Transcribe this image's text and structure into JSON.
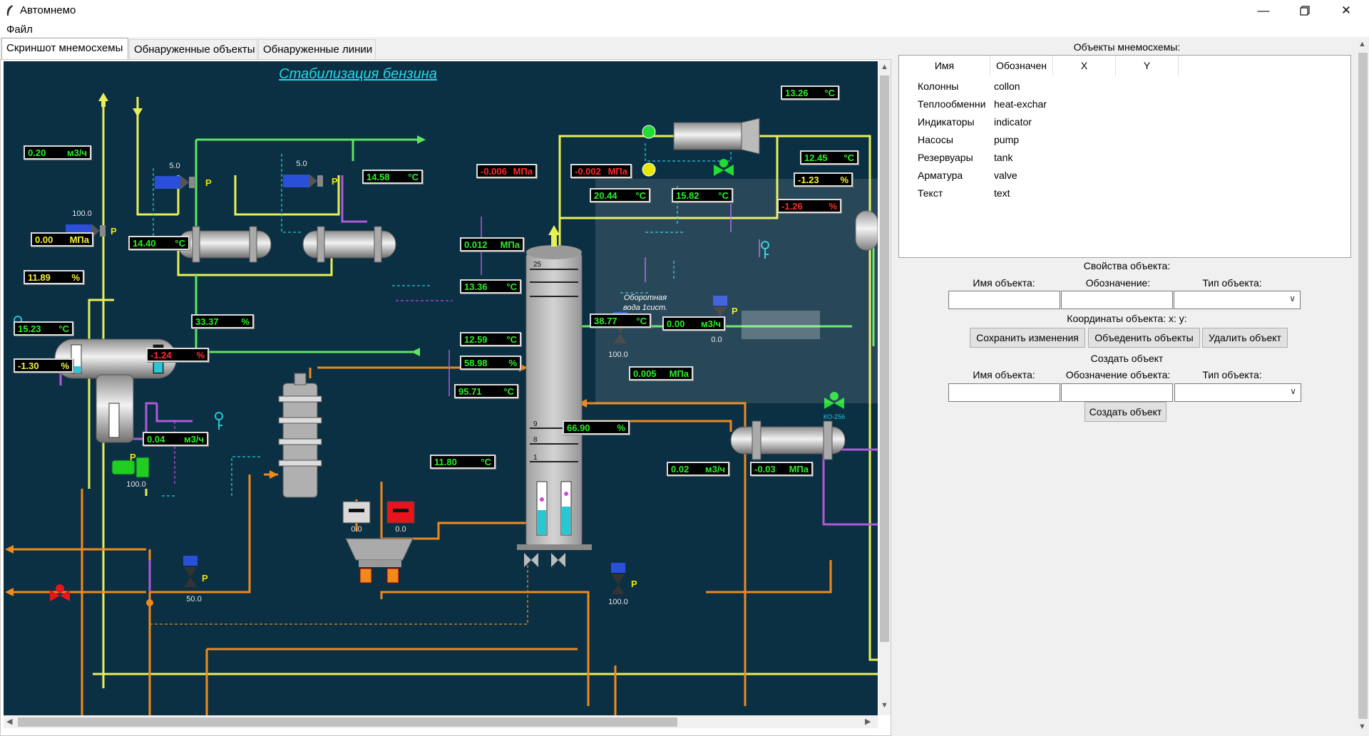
{
  "window": {
    "title": "Автомнемо",
    "menu_file": "Файл"
  },
  "tabs": [
    {
      "label": "Скриншот мнемосхемы",
      "active": true
    },
    {
      "label": "Обнаруженные объекты",
      "active": false
    },
    {
      "label": "Обнаруженные линии",
      "active": false
    }
  ],
  "scheme": {
    "title": "Стабилизация бензина",
    "annotation": "Оборотная вода 1сист.",
    "column_trays": [
      "25",
      "9",
      "8",
      "1"
    ],
    "indicators": [
      {
        "value": "0.20",
        "unit": "м3/ч",
        "color": "green"
      },
      {
        "value": "0.00",
        "unit": "МПа",
        "color": "yellow"
      },
      {
        "value": "14.40",
        "unit": "°С",
        "color": "green"
      },
      {
        "value": "11.89",
        "unit": "%",
        "color": "yellow"
      },
      {
        "value": "15.23",
        "unit": "°С",
        "color": "green"
      },
      {
        "value": "-1.30",
        "unit": "%",
        "color": "yellow"
      },
      {
        "value": "33.37",
        "unit": "%",
        "color": "green"
      },
      {
        "value": "-1.24",
        "unit": "%",
        "color": "red"
      },
      {
        "value": "14.58",
        "unit": "°С",
        "color": "green"
      },
      {
        "value": "0.04",
        "unit": "м3/ч",
        "color": "green"
      },
      {
        "value": "-0.006",
        "unit": "МПа",
        "color": "red"
      },
      {
        "value": "0.012",
        "unit": "МПа",
        "color": "green"
      },
      {
        "value": "13.36",
        "unit": "°С",
        "color": "green"
      },
      {
        "value": "12.59",
        "unit": "°С",
        "color": "green"
      },
      {
        "value": "58.98",
        "unit": "%",
        "color": "green"
      },
      {
        "value": "95.71",
        "unit": "°С",
        "color": "green"
      },
      {
        "value": "11.80",
        "unit": "°С",
        "color": "green"
      },
      {
        "value": "66.90",
        "unit": "%",
        "color": "green"
      },
      {
        "value": "-0.002",
        "unit": "МПа",
        "color": "red"
      },
      {
        "value": "20.44",
        "unit": "°С",
        "color": "green"
      },
      {
        "value": "15.82",
        "unit": "°С",
        "color": "green"
      },
      {
        "value": "38.77",
        "unit": "°С",
        "color": "green"
      },
      {
        "value": "0.00",
        "unit": "м3/ч",
        "color": "green"
      },
      {
        "value": "0.005",
        "unit": "МПа",
        "color": "green"
      },
      {
        "value": "0.02",
        "unit": "м3/ч",
        "color": "green"
      },
      {
        "value": "-0.03",
        "unit": "МПа",
        "color": "green"
      },
      {
        "value": "13.26",
        "unit": "°С",
        "color": "green"
      },
      {
        "value": "12.45",
        "unit": "°С",
        "color": "green"
      },
      {
        "value": "-1.23",
        "unit": "%",
        "color": "yellow"
      },
      {
        "value": "-1.26",
        "unit": "%",
        "color": "red"
      }
    ],
    "valve_values": [
      "5.0",
      "5.0",
      "100.0",
      "100.0",
      "50.0",
      "0.0",
      "100.0",
      "100.0",
      "0.0",
      "0.0"
    ],
    "valve_tag": "КО-256",
    "valve_letter": "P"
  },
  "right_panel": {
    "objects_title": "Объекты мнемосхемы:",
    "columns": [
      "Имя",
      "Обозначен",
      "X",
      "Y"
    ],
    "rows": [
      {
        "name": "Колонны",
        "code": "collon"
      },
      {
        "name": "Теплообменни",
        "code": "heat-exchar"
      },
      {
        "name": "Индикаторы",
        "code": "indicator"
      },
      {
        "name": "Насосы",
        "code": "pump"
      },
      {
        "name": "Резервуары",
        "code": "tank"
      },
      {
        "name": "Арматура",
        "code": "valve"
      },
      {
        "name": "Текст",
        "code": "text"
      }
    ],
    "props_title": "Свойства объекта:",
    "prop_name_label": "Имя объекта:",
    "prop_code_label": "Обозначение:",
    "prop_type_label": "Тип объекта:",
    "coords_label": "Координаты объекта: x:  y:",
    "save_button": "Сохранить изменения",
    "merge_button": "Объеденить объекты",
    "delete_button": "Удалить объект",
    "create_title": "Создать объект",
    "create_name_label": "Имя объекта:",
    "create_code_label": "Обозначение объекта:",
    "create_type_label": "Тип объекта:",
    "create_button": "Создать объект"
  },
  "colors": {
    "scheme_bg": "#0b2f43",
    "yellow_pipe": "#e8f055",
    "green_pipe": "#5ee660",
    "orange_pipe": "#f08a1c",
    "violet_line": "#b05ad8",
    "cyan_dash": "#27c7d6",
    "title_cyan": "#27d8e8"
  }
}
